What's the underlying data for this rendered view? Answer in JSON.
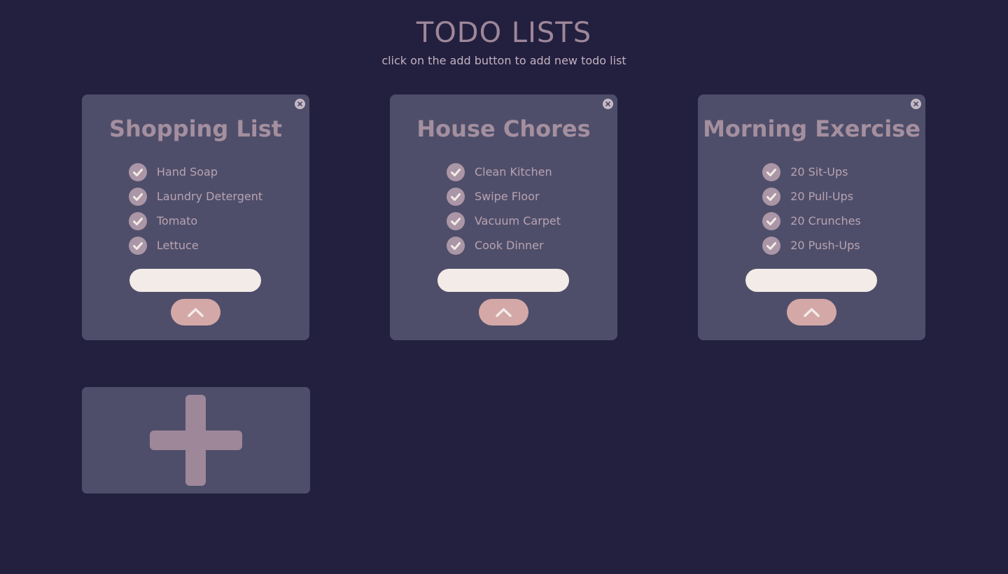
{
  "header": {
    "title": "TODO LISTS",
    "subtitle": "click on the add button to add new todo list"
  },
  "lists": [
    {
      "title": "Shopping List",
      "items": [
        "Hand Soap",
        "Laundry Detergent",
        "Tomato",
        "Lettuce"
      ],
      "input_value": ""
    },
    {
      "title": "House Chores",
      "items": [
        "Clean Kitchen",
        "Swipe Floor",
        "Vacuum Carpet",
        "Cook Dinner"
      ],
      "input_value": ""
    },
    {
      "title": "Morning Exercise",
      "items": [
        "20 Sit-Ups",
        "20 Pull-Ups",
        "20 Crunches",
        "20 Push-Ups"
      ],
      "input_value": ""
    }
  ],
  "icons": {
    "close": "close-icon",
    "check": "check-icon",
    "submit": "chevron-up-icon",
    "add": "plus-icon"
  },
  "colors": {
    "background": "#231f3f",
    "card": "#4f4e6a",
    "title": "#9d8799",
    "input": "#f3ebe7",
    "button": "#d3a8a6"
  }
}
